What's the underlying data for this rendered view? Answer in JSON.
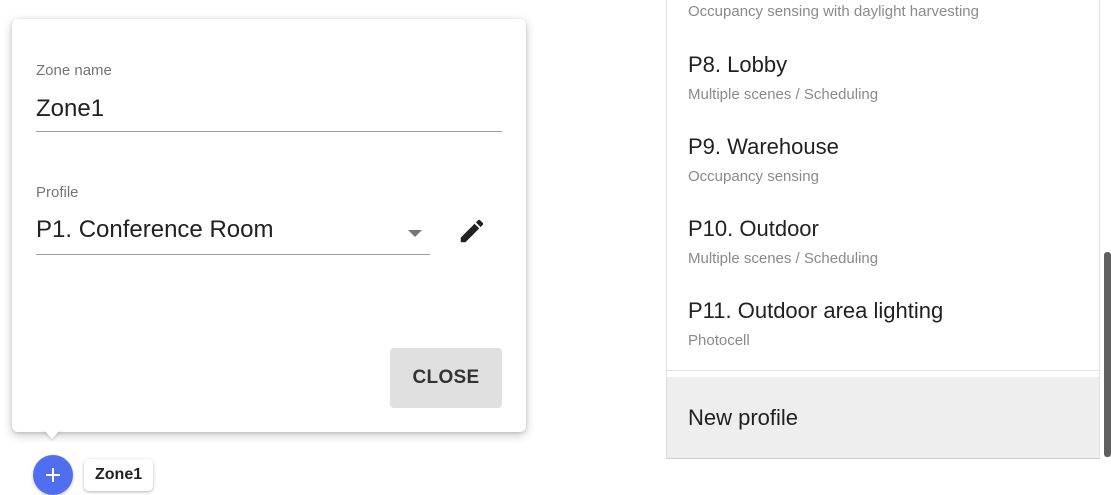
{
  "dialog": {
    "zone_name_label": "Zone name",
    "zone_name_value": "Zone1",
    "profile_label": "Profile",
    "profile_value": "P1. Conference Room",
    "close_label": "CLOSE"
  },
  "zone_chip": {
    "label": "Zone1",
    "fab_icon": "plus-icon"
  },
  "menu": {
    "partial_item_subtitle": "Occupancy sensing with daylight harvesting",
    "items": [
      {
        "title": "P8. Lobby",
        "subtitle": "Multiple scenes / Scheduling"
      },
      {
        "title": "P9. Warehouse",
        "subtitle": "Occupancy sensing"
      },
      {
        "title": "P10. Outdoor",
        "subtitle": "Multiple scenes / Scheduling"
      },
      {
        "title": "P11. Outdoor area lighting",
        "subtitle": "Photocell"
      }
    ],
    "new_profile_label": "New profile"
  },
  "colors": {
    "accent": "#4f6ef0",
    "button_bg": "#e0e0e0",
    "highlight_bg": "#eeeeee"
  }
}
